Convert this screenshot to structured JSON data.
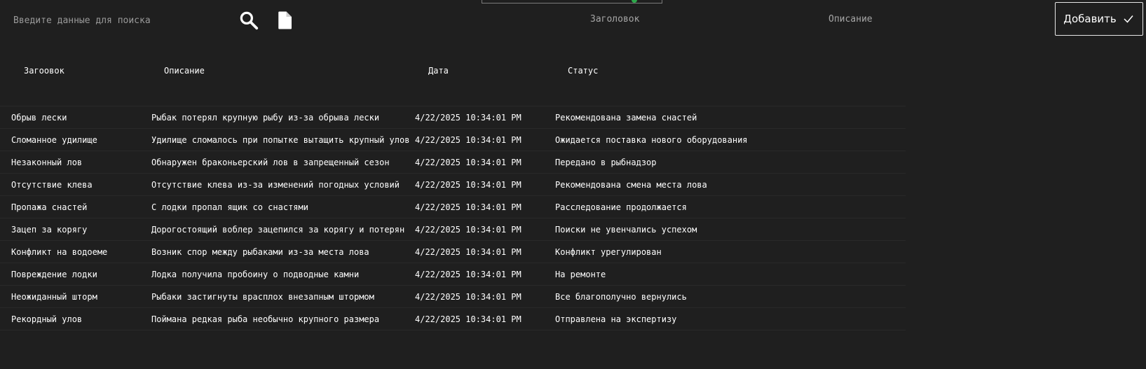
{
  "search": {
    "placeholder": "Введите данные для поиска"
  },
  "form": {
    "title_placeholder": "Заголовок",
    "description_placeholder": "Описание",
    "add_label": "Добавить"
  },
  "icons": {
    "search": "search-icon",
    "file": "file-icon",
    "check": "check-icon"
  },
  "table": {
    "headers": [
      "Загоовок",
      "Описание",
      "Дата",
      "Статус"
    ],
    "rows": [
      {
        "title": "Обрыв лески",
        "description": "Рыбак потерял крупную рыбу из-за обрыва лески",
        "date": "4/22/2025 10:34:01 PM",
        "status": "Рекомендована замена снастей"
      },
      {
        "title": "Сломанное удилище",
        "description": "Удилище сломалось при попытке вытащить крупный улов",
        "date": "4/22/2025 10:34:01 PM",
        "status": "Ожидается поставка нового оборудования"
      },
      {
        "title": "Незаконный лов",
        "description": "Обнаружен браконьерский лов в запрещенный сезон",
        "date": "4/22/2025 10:34:01 PM",
        "status": "Передано в рыбнадзор"
      },
      {
        "title": "Отсутствие клева",
        "description": "Отсутствие клева из-за изменений погодных условий",
        "date": "4/22/2025 10:34:01 PM",
        "status": "Рекомендована смена места лова"
      },
      {
        "title": "Пропажа снастей",
        "description": "С лодки пропал ящик со снастями",
        "date": "4/22/2025 10:34:01 PM",
        "status": "Расследование продолжается"
      },
      {
        "title": "Зацеп за корягу",
        "description": "Дорогостоящий воблер зацепился за корягу и потерян",
        "date": "4/22/2025 10:34:01 PM",
        "status": "Поиски не увенчались успехом"
      },
      {
        "title": "Конфликт на водоеме",
        "description": "Возник спор между рыбаками из-за места лова",
        "date": "4/22/2025 10:34:01 PM",
        "status": "Конфликт урегулирован"
      },
      {
        "title": "Повреждение лодки",
        "description": "Лодка получила пробоину о подводные камни",
        "date": "4/22/2025 10:34:01 PM",
        "status": "На ремонте"
      },
      {
        "title": "Неожиданный шторм",
        "description": "Рыбаки застигнуты врасплох внезапным штормом",
        "date": "4/22/2025 10:34:01 PM",
        "status": "Все благополучно вернулись"
      },
      {
        "title": "Рекордный улов",
        "description": "Поймана редкая рыба необычно крупного размера",
        "date": "4/22/2025 10:34:01 PM",
        "status": "Отправлена на экспертизу"
      }
    ]
  }
}
